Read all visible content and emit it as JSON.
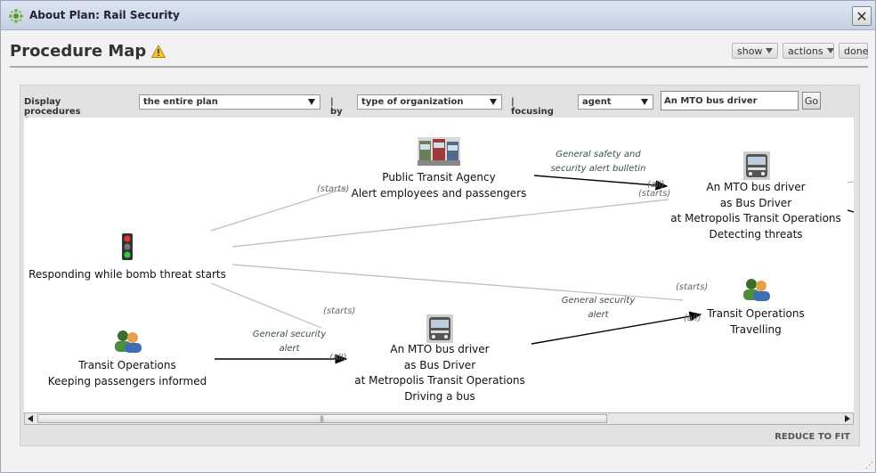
{
  "window": {
    "title": "About Plan: Rail Security",
    "close_icon": "close-icon"
  },
  "header": {
    "title": "Procedure Map",
    "warning_icon": "warning-icon"
  },
  "toolbar": {
    "show_label": "show",
    "actions_label": "actions",
    "done_label": "done"
  },
  "filters": {
    "display_label": "Display procedures from",
    "display_value": "the entire plan",
    "by_label": "| by",
    "by_value": "type of organization",
    "focus_label": "| focusing on",
    "focus_value": "agent",
    "agent_value": "An MTO bus driver",
    "go_label": "Go"
  },
  "map": {
    "nodes": {
      "bomb": {
        "lines": [
          "Responding while bomb threat starts"
        ],
        "icon": "traffic-light-icon"
      },
      "transit_info": {
        "lines": [
          "Transit Operations",
          "Keeping passengers informed"
        ],
        "icon": "people-icon"
      },
      "public_agency": {
        "lines": [
          "Public Transit Agency",
          "Alert employees and passengers"
        ],
        "icon": "buses-photo-icon"
      },
      "driver_detect": {
        "lines": [
          "An MTO bus driver",
          "as Bus Driver",
          "at Metropolis Transit Operations",
          "Detecting threats"
        ],
        "icon": "bus-photo-icon"
      },
      "transit_travel": {
        "lines": [
          "Transit Operations",
          "Travelling"
        ],
        "icon": "people-icon"
      },
      "driver_drive": {
        "lines": [
          "An MTO bus driver",
          "as Bus Driver",
          "at Metropolis Transit Operations",
          "Driving a bus"
        ],
        "icon": "bus-photo-icon"
      }
    },
    "edge_labels": {
      "bulletin": [
        "General safety and",
        "security alert bulletin"
      ],
      "alert_top": [
        "General security",
        "alert"
      ],
      "alert_bottom": [
        "General security",
        "alert"
      ]
    },
    "tags": {
      "starts": "(starts)",
      "all": "(all)"
    }
  },
  "footer": {
    "reduce_label": "REDUCE TO FIT",
    "resize_icon": "resize-grip-icon"
  }
}
